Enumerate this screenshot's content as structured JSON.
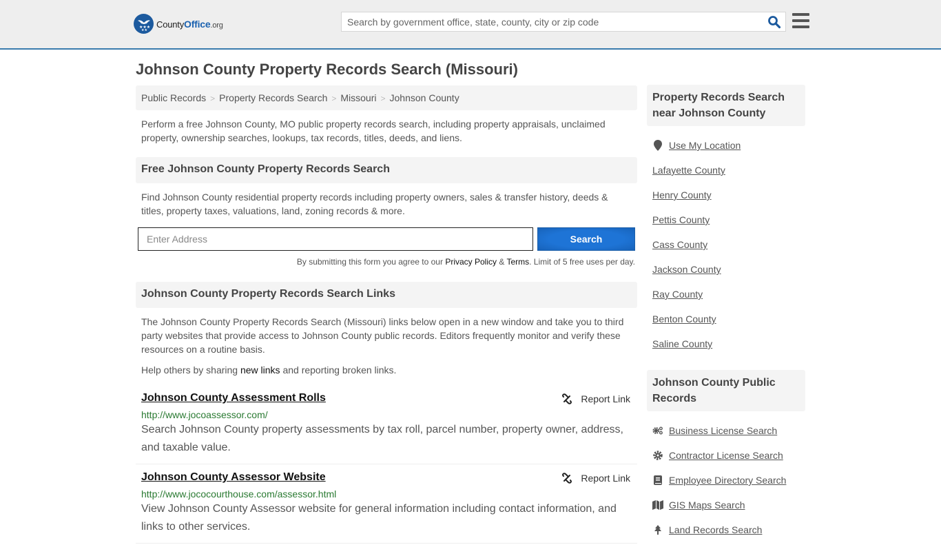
{
  "header": {
    "logo": {
      "county": "County",
      "office": "Office",
      "org": ".org"
    },
    "search_placeholder": "Search by government office, state, county, city or zip code"
  },
  "page_title": "Johnson County Property Records Search (Missouri)",
  "breadcrumb": [
    "Public Records",
    "Property Records Search",
    "Missouri",
    "Johnson County"
  ],
  "intro": "Perform a free Johnson County, MO public property records search, including property appraisals, unclaimed property, ownership searches, lookups, tax records, titles, deeds, and liens.",
  "free_search": {
    "heading": "Free Johnson County Property Records Search",
    "text": "Find Johnson County residential property records including property owners, sales & transfer history, deeds & titles, property taxes, valuations, land, zoning records & more.",
    "address_placeholder": "Enter Address",
    "button_label": "Search",
    "disclaimer_prefix": "By submitting this form you agree to our ",
    "privacy_label": "Privacy Policy",
    "amp": " & ",
    "terms_label": "Terms",
    "disclaimer_suffix": ". Limit of 5 free uses per day."
  },
  "links_section": {
    "heading": "Johnson County Property Records Search Links",
    "text": "The Johnson County Property Records Search (Missouri) links below open in a new window and take you to third party websites that provide access to Johnson County public records. Editors frequently monitor and verify these resources on a routine basis.",
    "help_prefix": "Help others by sharing ",
    "help_link": "new links",
    "help_suffix": " and reporting broken links.",
    "report_label": "Report Link",
    "items": [
      {
        "title": "Johnson County Assessment Rolls",
        "url": "http://www.jocoassessor.com/",
        "description": "Search Johnson County property assessments by tax roll, parcel number, property owner, address, and taxable value."
      },
      {
        "title": "Johnson County Assessor Website",
        "url": "http://www.jococourthouse.com/assessor.html",
        "description": "View Johnson County Assessor website for general information including contact information, and links to other services."
      }
    ]
  },
  "sidebar": {
    "nearby": {
      "heading": "Property Records Search near Johnson County",
      "use_location": "Use My Location",
      "counties": [
        "Lafayette County",
        "Henry County",
        "Pettis County",
        "Cass County",
        "Jackson County",
        "Ray County",
        "Benton County",
        "Saline County"
      ]
    },
    "public_records": {
      "heading": "Johnson County Public Records",
      "items": [
        {
          "label": "Business License Search",
          "icon": "cogs-icon"
        },
        {
          "label": "Contractor License Search",
          "icon": "gear-icon"
        },
        {
          "label": "Employee Directory Search",
          "icon": "book-icon"
        },
        {
          "label": "GIS Maps Search",
          "icon": "map-icon"
        },
        {
          "label": "Land Records Search",
          "icon": "tree-icon"
        }
      ]
    }
  },
  "colors": {
    "brand": "#1c5a9e",
    "header_border": "#3a7bad",
    "button": "#1e74d6",
    "url_green": "#2a7a32"
  }
}
